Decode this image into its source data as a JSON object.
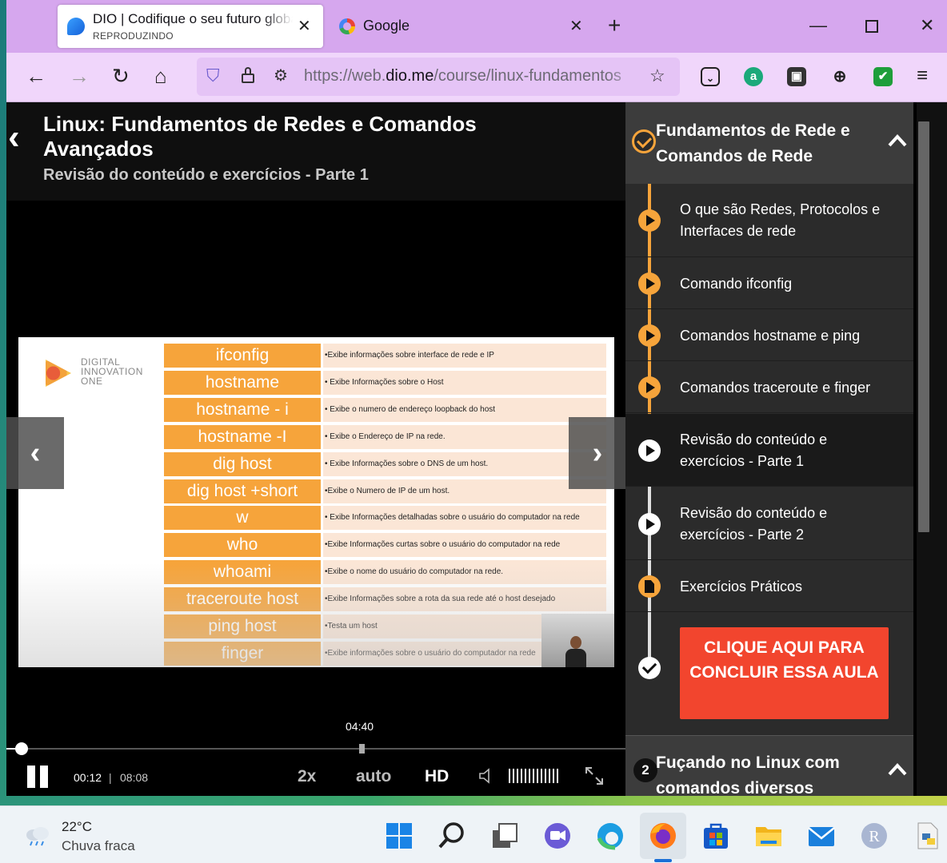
{
  "browser": {
    "tabs": [
      {
        "title": "DIO | Codifique o seu futuro global",
        "subtitle": "REPRODUZINDO"
      },
      {
        "title": "Google"
      }
    ],
    "url_prefix": "https://web.",
    "url_host": "dio.me",
    "url_path": "/course/linux-fundamentos"
  },
  "course": {
    "title": "Linux: Fundamentos de Redes e Comandos Avançados",
    "lesson_title": "Revisão do conteúdo e exercícios - Parte 1"
  },
  "slide": {
    "logo_lines": [
      "DIGITAL",
      "INNOVATION",
      "ONE"
    ],
    "rows": [
      {
        "cmd": "ifconfig",
        "desc": "•Exibe informações sobre interface de rede e IP"
      },
      {
        "cmd": "hostname",
        "desc": "• Exibe Informações sobre o Host"
      },
      {
        "cmd": "hostname - i",
        "desc": "• Exibe o numero de endereço loopback do host"
      },
      {
        "cmd": "hostname -I",
        "desc": "• Exibe o Endereço de IP na rede."
      },
      {
        "cmd": "dig host",
        "desc": "• Exibe Informações sobre o DNS de um host."
      },
      {
        "cmd": "dig host +short",
        "desc": "•Exibe o Numero de IP de um host."
      },
      {
        "cmd": "w",
        "desc": "• Exibe Informações detalhadas sobre o usuário do computador na rede"
      },
      {
        "cmd": "who",
        "desc": "•Exibe Informações curtas sobre o usuário do computador na rede"
      },
      {
        "cmd": "whoami",
        "desc": "•Exibe o nome do usuário do computador na rede."
      },
      {
        "cmd": "traceroute host",
        "desc": "•Exibe Informações sobre a rota da sua rede até o host desejado"
      },
      {
        "cmd": "ping host",
        "desc": "•Testa um host"
      },
      {
        "cmd": "finger",
        "desc": "•Exibe informações sobre o usuário do computador na rede"
      }
    ]
  },
  "player": {
    "hover_time": "04:40",
    "current_time": "00:12",
    "separator": "|",
    "duration": "08:08",
    "speed": "2x",
    "quality_auto": "auto",
    "quality_hd": "HD",
    "progress_fraction": 0.025
  },
  "sidebar": {
    "module_title": "Fundamentos de Rede e Comandos de Rede",
    "lessons": [
      {
        "label": "O que são Redes, Protocolos e Interfaces de rede",
        "status": "watched"
      },
      {
        "label": "Comando ifconfig",
        "status": "watched"
      },
      {
        "label": "Comandos hostname e ping",
        "status": "watched"
      },
      {
        "label": "Comandos traceroute e finger",
        "status": "watched"
      },
      {
        "label": "Revisão do conteúdo e exercícios - Parte 1",
        "status": "current"
      },
      {
        "label": "Revisão do conteúdo e exercícios - Parte 2",
        "status": "pending"
      },
      {
        "label": "Exercícios Práticos",
        "status": "watched"
      }
    ],
    "complete_button": "CLIQUE AQUI PARA CONCLUIR ESSA AULA",
    "next_module_number": "2",
    "next_module_title": "Fuçando no Linux com comandos diversos"
  },
  "taskbar": {
    "temperature": "22°C",
    "weather": "Chuva fraca"
  },
  "colors": {
    "accent_orange": "#f6a43b",
    "complete_red": "#f2452e",
    "tab_bar": "#d6a7ee"
  }
}
